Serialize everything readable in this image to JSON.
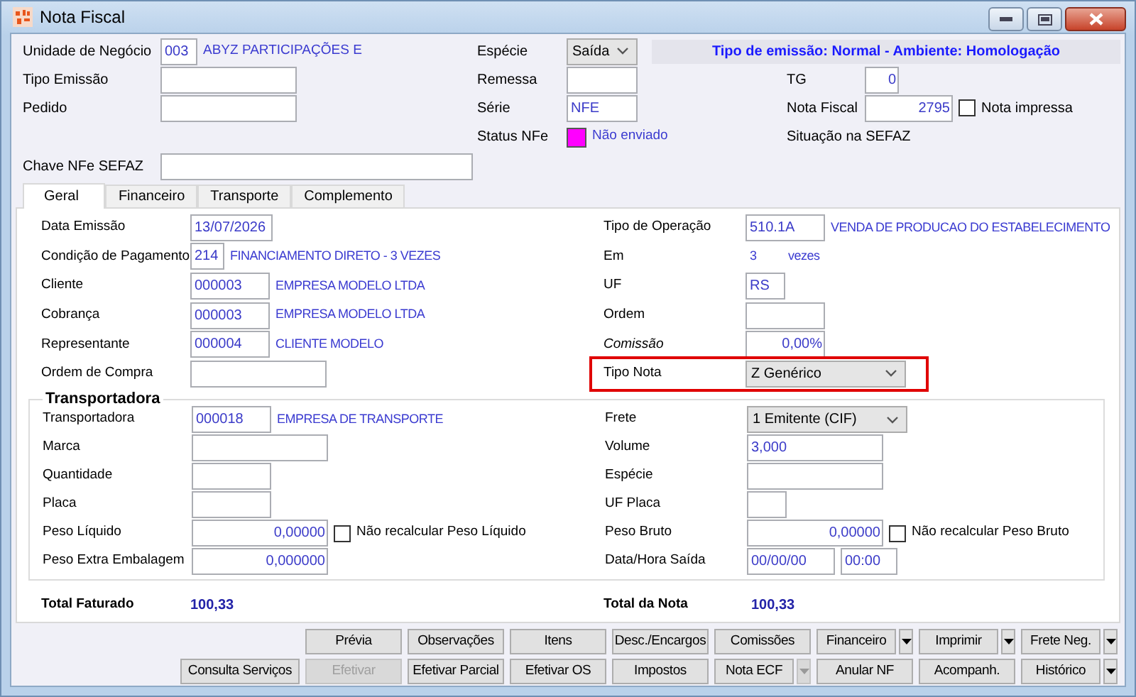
{
  "window": {
    "title": "Nota Fiscal"
  },
  "header": {
    "unidade_negocio": {
      "label": "Unidade de Negócio",
      "code": "003",
      "name": "ABYZ PARTICIPAÇÕES E"
    },
    "especie": {
      "label": "Espécie",
      "value": "Saída"
    },
    "banner": "Tipo de emissão: Normal - Ambiente: Homologação",
    "tipo_emissao": {
      "label": "Tipo Emissão"
    },
    "remessa": {
      "label": "Remessa"
    },
    "tg": {
      "label": "TG",
      "value": "0"
    },
    "pedido": {
      "label": "Pedido"
    },
    "serie": {
      "label": "Série",
      "value": "NFE"
    },
    "nota_fiscal": {
      "label": "Nota Fiscal",
      "value": "2795",
      "checkbox": {
        "label": "Nota impressa",
        "checked": false
      }
    },
    "status_nfe": {
      "label": "Status NFe",
      "color": "#ff00ff",
      "text": "Não enviado"
    },
    "situacao_sefaz": {
      "label": "Situação na SEFAZ"
    },
    "chave_nfe": {
      "label": "Chave NFe SEFAZ"
    }
  },
  "tabs": [
    {
      "label": "Geral",
      "selected": true
    },
    {
      "label": "Financeiro",
      "selected": false
    },
    {
      "label": "Transporte",
      "selected": false
    },
    {
      "label": "Complemento",
      "selected": false
    }
  ],
  "geral": {
    "left": [
      {
        "kind": "text",
        "label": "Data Emissão",
        "value": "13/07/2026"
      },
      {
        "kind": "code",
        "label": "Condição de Pagamento",
        "value": "214",
        "name": "FINANCIAMENTO DIRETO - 3 VEZES"
      },
      {
        "kind": "code",
        "label": "Cliente",
        "value": "000003",
        "name": "EMPRESA MODELO LTDA"
      },
      {
        "kind": "code",
        "label": "Cobrança",
        "value": "000003",
        "name": "EMPRESA MODELO LTDA"
      },
      {
        "kind": "code",
        "label": "Representante",
        "value": "000004",
        "name": "CLIENTE MODELO"
      },
      {
        "kind": "text",
        "label": "Ordem de Compra"
      }
    ],
    "right": [
      {
        "kind": "code",
        "label": "Tipo de Operação",
        "value": "510.1A",
        "name": "VENDA DE PRODUCAO DO ESTABELECIMENTO"
      },
      {
        "kind": "static",
        "label": "Em",
        "value": "3",
        "unit": "vezes"
      },
      {
        "kind": "text",
        "label": "UF",
        "value": "RS"
      },
      {
        "kind": "text",
        "label": "Ordem"
      },
      {
        "kind": "number",
        "label": "Comissão",
        "value": "0,00%",
        "italic": true
      },
      {
        "kind": "select",
        "label": "Tipo Nota",
        "value": "Z Genérico",
        "highlighted": true
      }
    ]
  },
  "transportadora": {
    "title": "Transportadora",
    "left": [
      {
        "kind": "code",
        "label": "Transportadora",
        "value": "000018",
        "name": "EMPRESA DE TRANSPORTE"
      },
      {
        "kind": "text",
        "label": "Marca"
      },
      {
        "kind": "text",
        "label": "Quantidade"
      },
      {
        "kind": "text",
        "label": "Placa"
      },
      {
        "kind": "number",
        "label": "Peso Líquido",
        "value": "0,00000",
        "checkbox": {
          "label": "Não recalcular Peso Líquido",
          "checked": false
        }
      },
      {
        "kind": "number",
        "label": "Peso Extra Embalagem",
        "value": "0,000000"
      }
    ],
    "right": [
      {
        "kind": "select",
        "label": "Frete",
        "value": "1 Emitente (CIF)"
      },
      {
        "kind": "text",
        "label": "Volume",
        "value": "3,000"
      },
      {
        "kind": "text",
        "label": "Espécie"
      },
      {
        "kind": "text",
        "label": "UF Placa"
      },
      {
        "kind": "number",
        "label": "Peso Bruto",
        "value": "0,00000",
        "checkbox": {
          "label": "Não recalcular Peso Bruto",
          "checked": false
        }
      },
      {
        "kind": "pair",
        "label": "Data/Hora Saída",
        "values": [
          "00/00/00",
          "00:00"
        ]
      }
    ]
  },
  "totals": [
    {
      "label": "Total Faturado",
      "value": "100,33"
    },
    {
      "label": "Total da Nota",
      "value": "100,33"
    }
  ],
  "buttons": [
    [
      {
        "label": "Prévia",
        "disabled": false
      },
      {
        "label": "Observações",
        "disabled": false
      },
      {
        "label": "Itens",
        "disabled": false
      },
      {
        "label": "Desc./Encargos",
        "disabled": false
      },
      {
        "label": "Comissões",
        "disabled": false
      },
      {
        "label": "Financeiro",
        "disabled": false,
        "menu": {
          "disabled": false
        }
      },
      {
        "label": "Imprimir",
        "disabled": false,
        "menu": {
          "disabled": false
        }
      },
      {
        "label": "Frete Neg.",
        "disabled": false,
        "menu": {
          "disabled": false
        }
      }
    ],
    [
      {
        "label": "Consulta Serviços",
        "disabled": false
      },
      {
        "label": "Efetivar",
        "disabled": true
      },
      {
        "label": "Efetivar Parcial",
        "disabled": false
      },
      {
        "label": "Efetivar OS",
        "disabled": false
      },
      {
        "label": "Impostos",
        "disabled": false
      },
      {
        "label": "Nota ECF",
        "disabled": false,
        "menu": {
          "disabled": true
        }
      },
      {
        "label": "Anular NF",
        "disabled": false
      },
      {
        "label": "Acompanh.",
        "disabled": false
      },
      {
        "label": "Histórico",
        "disabled": false,
        "menu": {
          "disabled": false
        }
      }
    ]
  ]
}
